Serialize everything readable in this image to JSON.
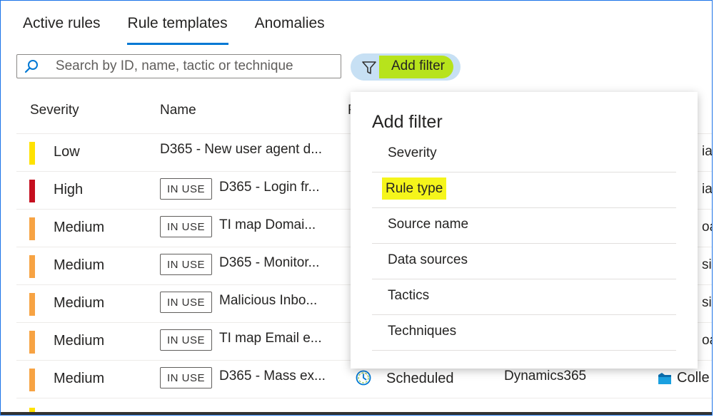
{
  "tabs": [
    "Active rules",
    "Rule templates",
    "Anomalies"
  ],
  "active_tab": "Rule templates",
  "search": {
    "placeholder": "Search by ID, name, tactic or technique"
  },
  "add_filter_button": "Add filter",
  "columns": {
    "severity": "Severity",
    "name": "Name",
    "rule_type_partial": "R"
  },
  "rows": [
    {
      "severity": "Low",
      "color": "#ffe200",
      "in_use": false,
      "badge": "",
      "name": "D365 - New user agent d...",
      "right_partial": "ial"
    },
    {
      "severity": "High",
      "color": "#c50f1f",
      "in_use": true,
      "badge": "IN USE",
      "name": "D365 - Login fr...",
      "right_partial": "ial"
    },
    {
      "severity": "Medium",
      "color": "#f7a343",
      "in_use": true,
      "badge": "IN USE",
      "name": "TI map Domai...",
      "right_partial": "oac"
    },
    {
      "severity": "Medium",
      "color": "#f7a343",
      "in_use": true,
      "badge": "IN USE",
      "name": "D365 - Monitor...",
      "right_partial": "sis"
    },
    {
      "severity": "Medium",
      "color": "#f7a343",
      "in_use": true,
      "badge": "IN USE",
      "name": "Malicious Inbo...",
      "right_partial": "sis"
    },
    {
      "severity": "Medium",
      "color": "#f7a343",
      "in_use": true,
      "badge": "IN USE",
      "name": "TI map Email e...",
      "right_partial": "oac"
    },
    {
      "severity": "Medium",
      "color": "#f7a343",
      "in_use": true,
      "badge": "IN USE",
      "name": "D365 - Mass ex...",
      "rule_type": "Scheduled",
      "source": "Dynamics365",
      "tactic": "Colle"
    }
  ],
  "filter_panel": {
    "title": "Add filter",
    "options": [
      "Severity",
      "Rule type",
      "Source name",
      "Data sources",
      "Tactics",
      "Techniques"
    ],
    "highlighted": "Rule type"
  }
}
